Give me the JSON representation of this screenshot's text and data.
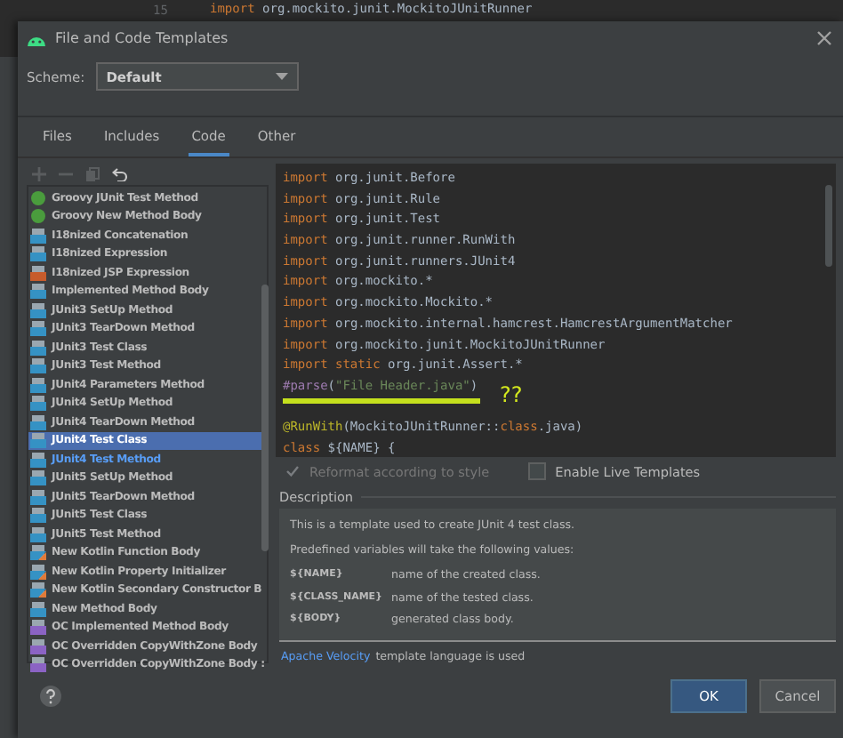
{
  "background_editor": {
    "line_number": "15",
    "code": [
      {
        "kind": "keyword",
        "text": "import"
      },
      {
        "kind": "plain",
        "text": " org.mockito.junit.MockitoJUnitRunner"
      }
    ]
  },
  "window": {
    "title": "File and Code Templates"
  },
  "scheme": {
    "label": "Scheme:",
    "value": "Default"
  },
  "tabs": [
    {
      "label": "Files",
      "selected": false
    },
    {
      "label": "Includes",
      "selected": false
    },
    {
      "label": "Code",
      "selected": true
    },
    {
      "label": "Other",
      "selected": false
    }
  ],
  "templates": [
    {
      "label": "Groovy JUnit Test Method",
      "kind": "groovy",
      "selected": false,
      "modified": false
    },
    {
      "label": "Groovy New Method Body",
      "kind": "groovy",
      "selected": false,
      "modified": false
    },
    {
      "label": "I18nized Concatenation",
      "kind": "java",
      "selected": false,
      "modified": false
    },
    {
      "label": "I18nized Expression",
      "kind": "java",
      "selected": false,
      "modified": false
    },
    {
      "label": "I18nized JSP Expression",
      "kind": "jsp",
      "selected": false,
      "modified": false
    },
    {
      "label": "Implemented Method Body",
      "kind": "java",
      "selected": false,
      "modified": false
    },
    {
      "label": "JUnit3 SetUp Method",
      "kind": "java",
      "selected": false,
      "modified": false
    },
    {
      "label": "JUnit3 TearDown Method",
      "kind": "java",
      "selected": false,
      "modified": false
    },
    {
      "label": "JUnit3 Test Class",
      "kind": "java",
      "selected": false,
      "modified": false
    },
    {
      "label": "JUnit3 Test Method",
      "kind": "java",
      "selected": false,
      "modified": false
    },
    {
      "label": "JUnit4 Parameters Method",
      "kind": "java",
      "selected": false,
      "modified": false
    },
    {
      "label": "JUnit4 SetUp Method",
      "kind": "java",
      "selected": false,
      "modified": false
    },
    {
      "label": "JUnit4 TearDown Method",
      "kind": "java",
      "selected": false,
      "modified": false
    },
    {
      "label": "JUnit4 Test Class",
      "kind": "java",
      "selected": true,
      "modified": false
    },
    {
      "label": "JUnit4 Test Method",
      "kind": "java",
      "selected": false,
      "modified": true
    },
    {
      "label": "JUnit5 SetUp Method",
      "kind": "java",
      "selected": false,
      "modified": false
    },
    {
      "label": "JUnit5 TearDown Method",
      "kind": "java",
      "selected": false,
      "modified": false
    },
    {
      "label": "JUnit5 Test Class",
      "kind": "java",
      "selected": false,
      "modified": false
    },
    {
      "label": "JUnit5 Test Method",
      "kind": "java",
      "selected": false,
      "modified": false
    },
    {
      "label": "New Kotlin Function Body",
      "kind": "kotlin",
      "selected": false,
      "modified": false
    },
    {
      "label": "New Kotlin Property Initializer",
      "kind": "kotlin",
      "selected": false,
      "modified": false
    },
    {
      "label": "New Kotlin Secondary Constructor B",
      "kind": "kotlin",
      "selected": false,
      "modified": false
    },
    {
      "label": "New Method Body",
      "kind": "java",
      "selected": false,
      "modified": false
    },
    {
      "label": "OC Implemented Method Body",
      "kind": "oc",
      "selected": false,
      "modified": false
    },
    {
      "label": "OC Overridden CopyWithZone Body",
      "kind": "oc",
      "selected": false,
      "modified": false
    },
    {
      "label": "OC Overridden CopyWithZone Body :",
      "kind": "oc",
      "selected": false,
      "modified": false
    }
  ],
  "editor": {
    "lines": [
      {
        "tokens": [
          {
            "kind": "keyword",
            "text": "import"
          },
          {
            "kind": "plain",
            "text": " org.junit.Before"
          }
        ]
      },
      {
        "tokens": [
          {
            "kind": "keyword",
            "text": "import"
          },
          {
            "kind": "plain",
            "text": " org.junit.Rule"
          }
        ]
      },
      {
        "tokens": [
          {
            "kind": "keyword",
            "text": "import"
          },
          {
            "kind": "plain",
            "text": " org.junit.Test"
          }
        ]
      },
      {
        "tokens": [
          {
            "kind": "keyword",
            "text": "import"
          },
          {
            "kind": "plain",
            "text": " org.junit.runner.RunWith"
          }
        ]
      },
      {
        "tokens": [
          {
            "kind": "keyword",
            "text": "import"
          },
          {
            "kind": "plain",
            "text": " org.junit.runners.JUnit4"
          }
        ]
      },
      {
        "tokens": [
          {
            "kind": "keyword",
            "text": "import"
          },
          {
            "kind": "plain",
            "text": " org.mockito.*"
          }
        ]
      },
      {
        "tokens": [
          {
            "kind": "keyword",
            "text": "import"
          },
          {
            "kind": "plain",
            "text": " org.mockito.Mockito.*"
          }
        ]
      },
      {
        "tokens": [
          {
            "kind": "keyword",
            "text": "import"
          },
          {
            "kind": "plain",
            "text": " org.mockito.internal.hamcrest.HamcrestArgumentMatcher"
          }
        ]
      },
      {
        "tokens": [
          {
            "kind": "keyword",
            "text": "import"
          },
          {
            "kind": "plain",
            "text": " org.mockito.junit.MockitoJUnitRunner"
          }
        ]
      },
      {
        "tokens": [
          {
            "kind": "keyword",
            "text": "import static"
          },
          {
            "kind": "plain",
            "text": " org.junit.Assert.*"
          }
        ]
      },
      {
        "tokens": [
          {
            "kind": "directive",
            "text": "#parse"
          },
          {
            "kind": "plain",
            "text": "("
          },
          {
            "kind": "string",
            "text": "\"File Header.java\""
          },
          {
            "kind": "plain",
            "text": ")"
          }
        ],
        "mark": "??"
      },
      {
        "tokens": [
          {
            "kind": "annotation",
            "text": "@RunWith"
          },
          {
            "kind": "plain",
            "text": "(MockitoJUnitRunner::"
          },
          {
            "kind": "keyword",
            "text": "class"
          },
          {
            "kind": "plain",
            "text": ".java)"
          }
        ]
      },
      {
        "tokens": [
          {
            "kind": "keyword",
            "text": "class"
          },
          {
            "kind": "plain",
            "text": " ${NAME} {"
          }
        ]
      }
    ]
  },
  "options": [
    {
      "label": "Reformat according to style",
      "checked": true,
      "disabled": true
    },
    {
      "label": "Enable Live Templates",
      "checked": false,
      "disabled": false
    }
  ],
  "description": {
    "heading": "Description",
    "intro": "This is a template used to create JUnit 4 test class.",
    "lead": "Predefined variables will take the following values:",
    "variables": [
      {
        "name": "${NAME}",
        "text": "name of the created class."
      },
      {
        "name": "${CLASS_NAME}",
        "text": "name of the tested class."
      },
      {
        "name": "${BODY}",
        "text": "generated class body."
      }
    ],
    "link": "Apache Velocity",
    "footer": "template language is used"
  },
  "buttons": [
    {
      "label": "OK",
      "kind": "primary"
    },
    {
      "label": "Cancel",
      "kind": "secondary"
    }
  ]
}
